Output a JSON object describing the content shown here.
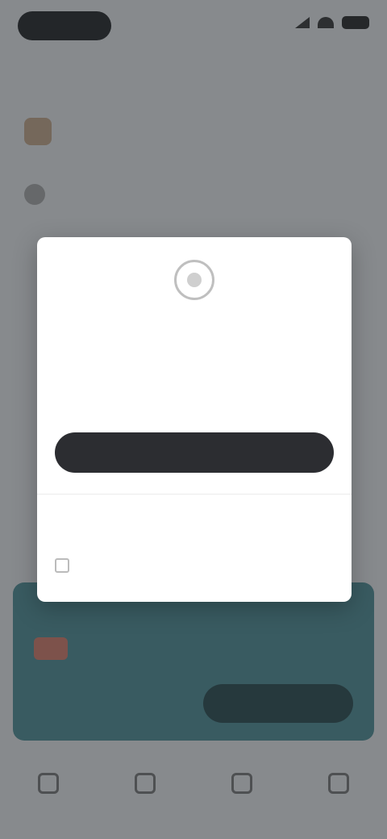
{
  "status_bar": {
    "time": "",
    "icons": [
      "signal-icon",
      "wifi-icon",
      "battery-icon"
    ]
  },
  "header": {
    "title": ""
  },
  "background_list": [
    {
      "label": "",
      "icon": "app-icon"
    },
    {
      "label": "",
      "icon": "user-icon"
    }
  ],
  "modal": {
    "icon": "info-icon",
    "title": "",
    "body": "",
    "note": "",
    "primary_label": "",
    "secondary_label": "",
    "checkbox_label": ""
  },
  "banner": {
    "text": "",
    "button_label": "",
    "color": "#4c8f96"
  },
  "tabbar": {
    "tabs": [
      {
        "label": "",
        "icon": "home-icon"
      },
      {
        "label": "",
        "icon": "search-icon"
      },
      {
        "label": "",
        "icon": "message-icon"
      },
      {
        "label": "",
        "icon": "profile-icon"
      }
    ]
  }
}
